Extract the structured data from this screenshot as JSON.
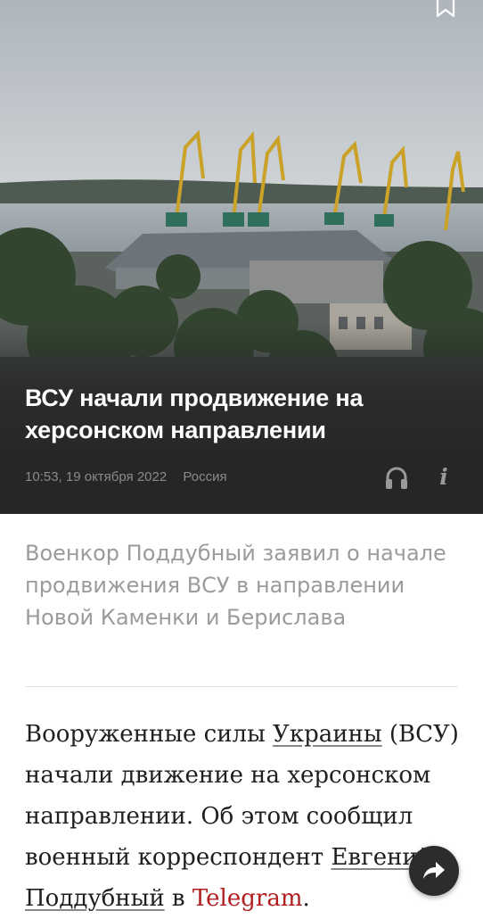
{
  "article": {
    "title": "ВСУ начали продвижение на херсонском направлении",
    "timestamp": "10:53, 19 октября 2022",
    "category": "Россия",
    "lead": "Военкор Поддубный заявил о начале продвижения ВСУ в направлении Новой Каменки и Берислава",
    "body": {
      "part1": "Вооруженные силы ",
      "link_ukraine": "Украины",
      "part2": " (ВСУ) начали движение на херсонском направлении. Об этом сообщил военный корреспондент ",
      "link_author": "Евгений Поддубный",
      "part3": " в ",
      "link_telegram": "Telegram",
      "part4": "."
    }
  },
  "icons": {
    "bookmark": "bookmark-icon",
    "listen": "headphones-icon",
    "info": "i",
    "share": "share-arrow-icon"
  },
  "colors": {
    "hero_background": "#262626",
    "title_text": "#ffffff",
    "meta_text": "#8a8a8a",
    "lead_text": "#9b9b9b",
    "body_text": "#1f1f1f",
    "telegram_link": "#b21e1e",
    "share_button": "#2c2c2c"
  }
}
